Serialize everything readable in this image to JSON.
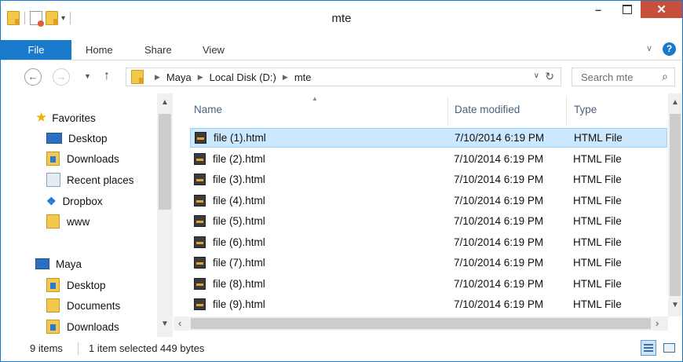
{
  "window": {
    "title": "mte"
  },
  "titlebar": {
    "min": "–",
    "close": "✕"
  },
  "ribbon": {
    "tabs": [
      "File",
      "Home",
      "Share",
      "View"
    ],
    "help": "?"
  },
  "address": {
    "crumbs": [
      "Maya",
      "Local Disk (D:)",
      "mte"
    ],
    "search_placeholder": "Search mte"
  },
  "navpane": {
    "favorites_label": "Favorites",
    "favorites": [
      "Desktop",
      "Downloads",
      "Recent places",
      "Dropbox",
      "www"
    ],
    "computer_label": "Maya",
    "computer": [
      "Desktop",
      "Documents",
      "Downloads"
    ]
  },
  "columns": {
    "name": "Name",
    "date": "Date modified",
    "type": "Type"
  },
  "files": [
    {
      "name": "file (1).html",
      "date": "7/10/2014 6:19 PM",
      "type": "HTML File",
      "selected": true
    },
    {
      "name": "file (2).html",
      "date": "7/10/2014 6:19 PM",
      "type": "HTML File"
    },
    {
      "name": "file (3).html",
      "date": "7/10/2014 6:19 PM",
      "type": "HTML File"
    },
    {
      "name": "file (4).html",
      "date": "7/10/2014 6:19 PM",
      "type": "HTML File"
    },
    {
      "name": "file (5).html",
      "date": "7/10/2014 6:19 PM",
      "type": "HTML File"
    },
    {
      "name": "file (6).html",
      "date": "7/10/2014 6:19 PM",
      "type": "HTML File"
    },
    {
      "name": "file (7).html",
      "date": "7/10/2014 6:19 PM",
      "type": "HTML File"
    },
    {
      "name": "file (8).html",
      "date": "7/10/2014 6:19 PM",
      "type": "HTML File"
    },
    {
      "name": "file (9).html",
      "date": "7/10/2014 6:19 PM",
      "type": "HTML File"
    }
  ],
  "status": {
    "count": "9 items",
    "selection": "1 item selected  449 bytes"
  },
  "colors": {
    "accent": "#1979ca",
    "close": "#c7503c",
    "selection": "#cce8ff"
  }
}
